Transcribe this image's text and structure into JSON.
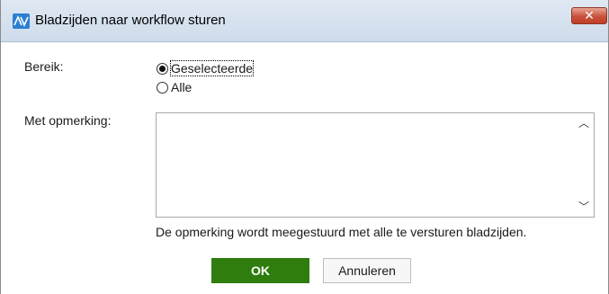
{
  "window": {
    "title": "Bladzijden naar workflow sturen",
    "close_symbol": "✕",
    "app_icon": "av-logo-icon"
  },
  "form": {
    "range_label": "Bereik:",
    "range_options": [
      {
        "label": "Geselecteerde",
        "selected": true
      },
      {
        "label": "Alle",
        "selected": false
      }
    ],
    "remark_label": "Met opmerking:",
    "remark_value": "",
    "hint": "De opmerking wordt meegestuurd met alle te versturen bladzijden."
  },
  "buttons": {
    "ok": "OK",
    "cancel": "Annuleren"
  },
  "colors": {
    "ok_button": "#2f7d0e",
    "close_button": "#c8503a",
    "titlebar": "#dfe8f3"
  }
}
